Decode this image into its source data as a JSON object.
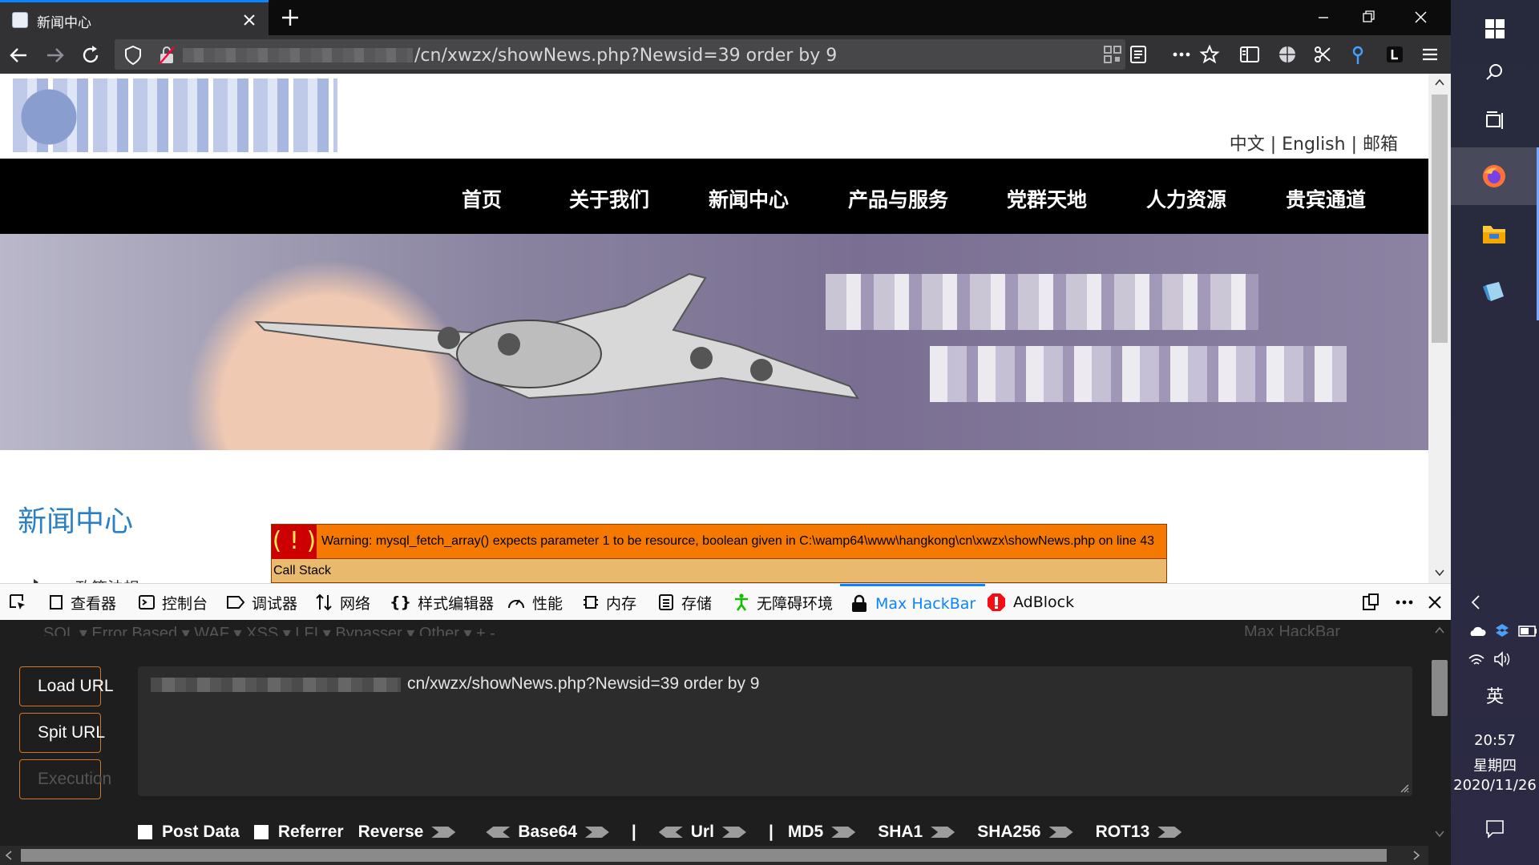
{
  "browser": {
    "tab_title": "新闻中心",
    "url_visible": "/cn/xwzx/showNews.php?Newsid=39 order by 9"
  },
  "site": {
    "lang_links": "中文 | English | 邮箱",
    "nav": [
      "首页",
      "关于我们",
      "新闻中心",
      "产品与服务",
      "党群天地",
      "人力资源",
      "贵宾通道"
    ],
    "section_title": "新闻中心",
    "sidebar_item": "政策法规"
  },
  "php_error": {
    "icon": "( ! )",
    "warning": "Warning: mysql_fetch_array() expects parameter 1 to be resource, boolean given in C:\\wamp64\\www\\hangkong\\cn\\xwzx\\showNews.php on line 43",
    "call_stack": "Call Stack"
  },
  "devtools": {
    "tabs": [
      "查看器",
      "控制台",
      "调试器",
      "网络",
      "样式编辑器",
      "性能",
      "内存",
      "存储",
      "无障碍环境",
      "Max HackBar",
      "AdBlock"
    ],
    "active_tab": "Max HackBar"
  },
  "hackbar": {
    "menu": "SQL ▾   Error Based ▾   WAF ▾   XSS ▾   LFI ▾   Bypasser ▾   Other ▾   +   -",
    "menu_brand": "Max HackBar",
    "load_url": "Load URL",
    "split_url": "Spit URL",
    "execution": "Execution",
    "url_visible": "cn/xwzx/showNews.php?Newsid=39 order by 9",
    "post_data": "Post Data",
    "referrer": "Referrer",
    "reverse": "Reverse",
    "base64": "Base64",
    "url": "Url",
    "md5": "MD5",
    "sha1": "SHA1",
    "sha256": "SHA256",
    "rot13": "ROT13",
    "sep": "|"
  },
  "taskbar": {
    "ime": "英",
    "time": "20:57",
    "day": "星期四",
    "date": "2020/11/26"
  },
  "colors": {
    "accent": "#0a84ff",
    "php_warning_bg": "#f57900",
    "php_callstack_bg": "#e9b96e",
    "site_title": "#2a7fc5"
  }
}
